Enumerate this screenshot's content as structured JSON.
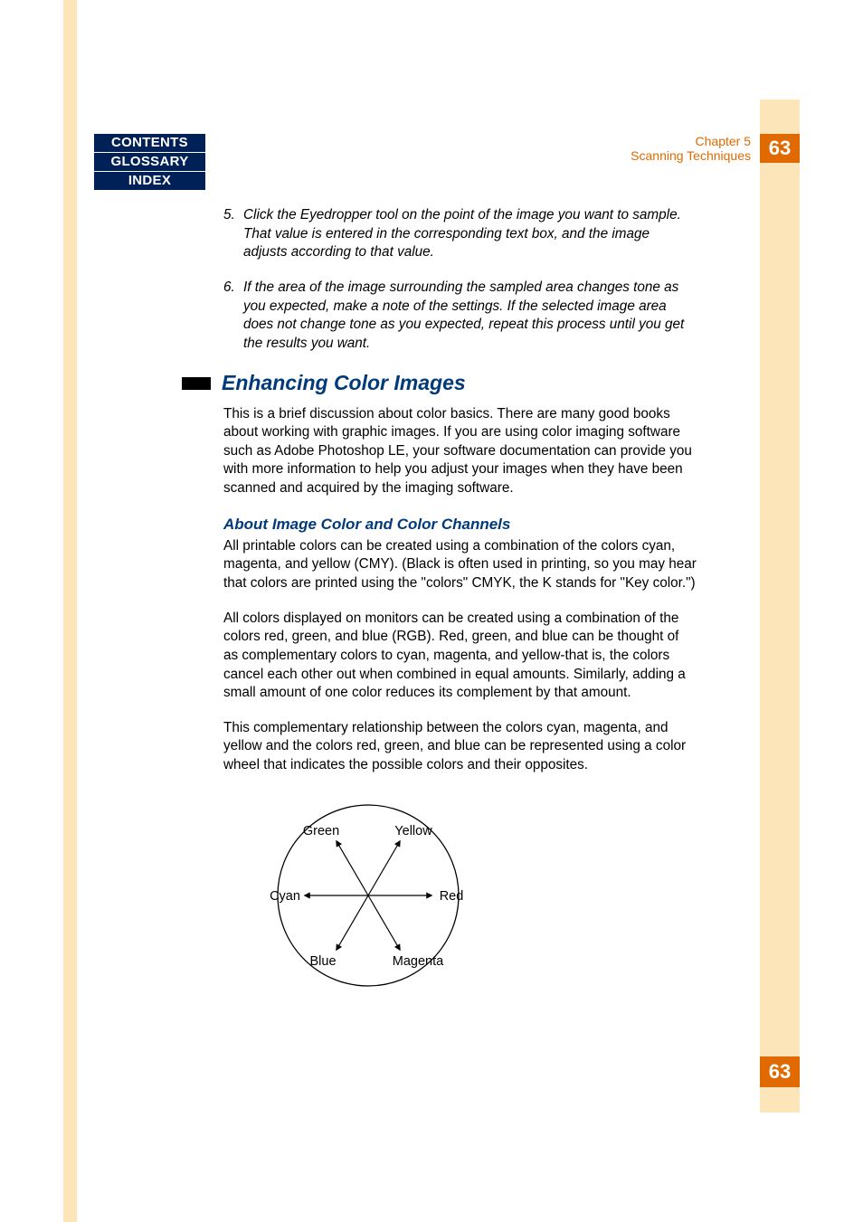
{
  "nav": {
    "items": [
      {
        "label": "CONTENTS"
      },
      {
        "label": "GLOSSARY"
      },
      {
        "label": "INDEX"
      }
    ]
  },
  "header": {
    "chapter": "Chapter 5",
    "title": "Scanning Techniques",
    "page": "63"
  },
  "footer": {
    "page": "63"
  },
  "steps": [
    {
      "num": "5.",
      "text": "Click the Eyedropper tool on the point of the image you want to sample. That value is entered in the corresponding text box, and the image adjusts according to that value."
    },
    {
      "num": "6.",
      "text": "If the area of the image surrounding the sampled area changes tone as you expected, make a note of the settings. If the selected image area does not change tone as you expected, repeat this process until you get the results you want."
    }
  ],
  "section": {
    "heading": "Enhancing Color Images",
    "intro": "This is a brief discussion about color basics. There are many good books about working with graphic images. If you are using color imaging software such as Adobe Photoshop LE, your software documentation can provide you with more information to help you adjust your images when they have been scanned and acquired by the imaging software.",
    "sub_heading": "About Image Color and Color Channels",
    "p1": "All printable colors can be created using a combination of the colors cyan, magenta, and yellow (CMY). (Black is often used in printing, so you may hear that colors are printed using the \"colors\" CMYK, the K stands for \"Key color.\")",
    "p2": "All colors displayed on monitors can be created using a combination of the colors red, green, and blue (RGB). Red, green, and blue can be thought of as complementary colors to cyan, magenta, and yellow-that is, the colors cancel each other out when combined in equal amounts. Similarly, adding a small amount of one color reduces its complement by that amount.",
    "p3": "This complementary relationship between the colors cyan, magenta, and yellow and the colors red, green, and blue can be represented using a color wheel that indicates the possible colors and their opposites."
  },
  "wheel": {
    "labels": {
      "green": "Green",
      "yellow": "Yellow",
      "cyan": "Cyan",
      "red": "Red",
      "blue": "Blue",
      "magenta": "Magenta"
    }
  }
}
